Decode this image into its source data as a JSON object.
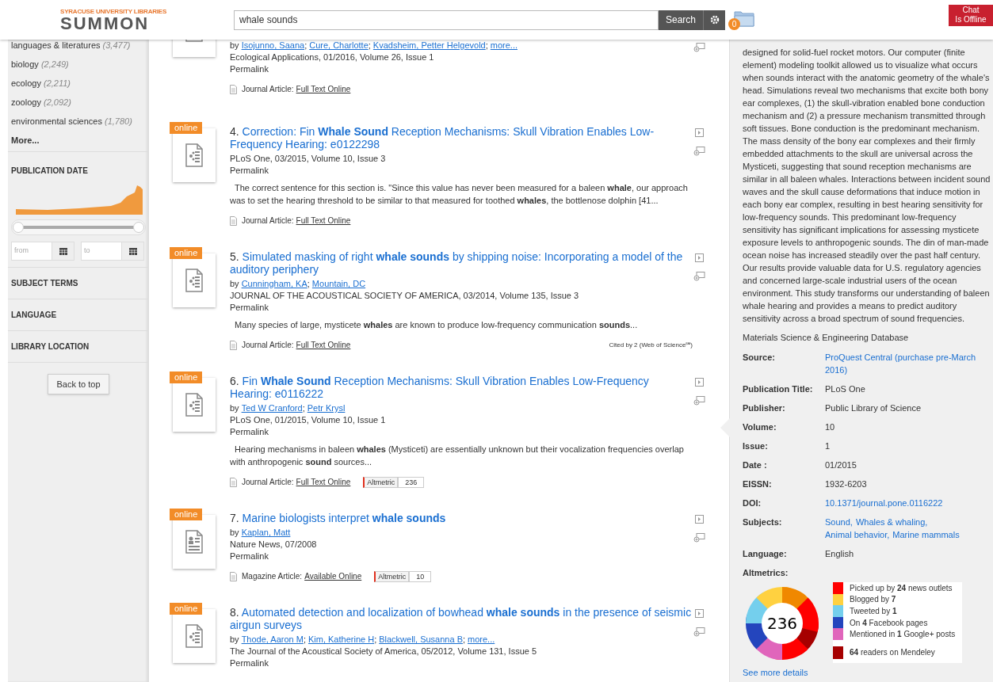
{
  "header": {
    "logo_top": "SYRACUSE UNIVERSITY LIBRARIES",
    "logo_main": "SUMMON",
    "search": {
      "value": "whale sounds"
    },
    "search_button": "Search",
    "folder_count": "0",
    "chat": [
      "Chat",
      "Is Offline"
    ]
  },
  "sidebar": {
    "subjects": [
      {
        "label": "languages & literatures",
        "count": "(3,477)"
      },
      {
        "label": "biology",
        "count": "(2,249)"
      },
      {
        "label": "ecology",
        "count": "(2,211)"
      },
      {
        "label": "zoology",
        "count": "(2,092)"
      },
      {
        "label": "environmental sciences",
        "count": "(1,780)"
      }
    ],
    "more": "More...",
    "date_heading": "PUBLICATION DATE",
    "date_range": {
      "level": 1
    },
    "from_placeholder": "from",
    "to_placeholder": "to",
    "sections": [
      "SUBJECT TERMS",
      "LANGUAGE",
      "LIBRARY LOCATION"
    ],
    "back_to_top": "Back to top"
  },
  "results": [
    {
      "kind": "article",
      "by": "by",
      "authors": [
        {
          "name": "Isojunno, Saana",
          "sep": ";"
        },
        {
          "name": "Cure, Charlotte",
          "sep": ";"
        },
        {
          "name": "Kvadsheim, Petter Helgevold",
          "sep": ";"
        }
      ],
      "more": "more...",
      "source": "Ecological Applications, 01/2016, Volume 26, Issue 1",
      "permalink": "Permalink",
      "format": "Journal Article:",
      "access": "Full Text Online"
    },
    {
      "kind": "article",
      "badge": "online",
      "number": "4.",
      "title": "Correction: Fin **Whale Sound** Reception Mechanisms: Skull Vibration Enables Low-Frequency Hearing: e0122298",
      "source": "PLoS One, 03/2015, Volume 10, Issue 3",
      "permalink": "Permalink",
      "snippet": "The correct sentence for this section is. \"Since this value has never been measured for a baleen **whale**, our approach was to set the hearing threshold to be similar to that measured for toothed **whales**, the bottlenose dolphin [41...",
      "format": "Journal Article:",
      "access": "Full Text Online"
    },
    {
      "kind": "article",
      "badge": "online",
      "number": "5.",
      "title": "Simulated masking of right **whale sounds** by shipping noise: Incorporating a model of the auditory periphery",
      "by": "by",
      "authors": [
        {
          "name": "Cunningham, KA",
          "sep": ";"
        },
        {
          "name": "Mountain, DC"
        }
      ],
      "source": "JOURNAL OF THE ACOUSTICAL SOCIETY OF AMERICA, 03/2014, Volume 135, Issue 3",
      "permalink": "Permalink",
      "snippet": "Many species of large, mysticete **whales** are known to produce low-frequency communication **sounds**...",
      "format": "Journal Article:",
      "access": "Full Text Online",
      "cited": "Cited by 2 (Web of Science℠)"
    },
    {
      "kind": "article",
      "badge": "online",
      "number": "6.",
      "title": "Fin **Whale Sound** Reception Mechanisms: Skull Vibration Enables Low-Frequency Hearing: e0116222",
      "by": "by",
      "authors": [
        {
          "name": "Ted W Cranford",
          "sep": ";"
        },
        {
          "name": "Petr Krysl"
        }
      ],
      "source": "PLoS One, 01/2015, Volume 10, Issue 1",
      "permalink": "Permalink",
      "snippet": "Hearing mechanisms in baleen **whales** (Mysticeti) are essentially unknown but their vocalization frequencies overlap with anthropogenic **sound** sources...",
      "format": "Journal Article:",
      "access": "Full Text Online",
      "altmetric": {
        "label": "Altmetric",
        "score": "236"
      }
    },
    {
      "kind": "magazine",
      "badge": "online",
      "number": "7.",
      "title": "Marine biologists interpret **whale sounds**",
      "by": "by",
      "authors": [
        {
          "name": "Kaplan, Matt"
        }
      ],
      "source": "Nature News, 07/2008",
      "permalink": "Permalink",
      "format": "Magazine Article:",
      "access": "Available Online",
      "altmetric": {
        "label": "Altmetric",
        "score": "10"
      }
    },
    {
      "kind": "article",
      "badge": "online",
      "number": "8.",
      "title": "Automated detection and localization of bowhead **whale sounds** in the presence of seismic airgun surveys",
      "by": "by",
      "authors": [
        {
          "name": "Thode, Aaron M",
          "sep": ";"
        },
        {
          "name": "Kim, Katherine H",
          "sep": ";"
        },
        {
          "name": "Blackwell, Susanna B",
          "sep": ";"
        }
      ],
      "more": "more...",
      "source": "The Journal of the Acoustical Society of America, 05/2012, Volume 131, Issue 5",
      "permalink": "Permalink"
    }
  ],
  "detail": {
    "abstract": "designed for solid-fuel rocket motors. Our computer (finite element) modeling toolkit allowed us to visualize what occurs when sounds interact with the anatomic geometry of the whale's head. Simulations reveal two mechanisms that excite both bony ear complexes, (1) the skull-vibration enabled bone conduction mechanism and (2) a pressure mechanism transmitted through soft tissues. Bone conduction is the predominant mechanism. The mass density of the bony ear complexes and their firmly embedded attachments to the skull are universal across the Mysticeti, suggesting that sound reception mechanisms are similar in all baleen whales. Interactions between incident sound waves and the skull cause deformations that induce motion in each bony ear complex, resulting in best hearing sensitivity for low-frequency sounds. This predominant low-frequency sensitivity has significant implications for assessing mysticete exposure levels to anthropogenic sounds. The din of man-made ocean noise has increased steadily over the past half century. Our results provide valuable data for U.S. regulatory agencies and concerned large-scale industrial users of the ocean environment. This study transforms our understanding of baleen whale hearing and provides a means to predict auditory sensitivity across a broad spectrum of sound frequencies.",
    "database": "Materials Science & Engineering Database",
    "fields": [
      {
        "label": "Source:",
        "kind": "link",
        "values": [
          "ProQuest Central (purchase pre-March 2016)"
        ]
      },
      {
        "label": "Publication Title:",
        "kind": "text",
        "values": [
          "PLoS One"
        ]
      },
      {
        "label": "Publisher:",
        "kind": "text",
        "values": [
          "Public Library of Science"
        ]
      },
      {
        "label": "Volume:",
        "kind": "text",
        "values": [
          "10"
        ]
      },
      {
        "label": "Issue:",
        "kind": "text",
        "values": [
          "1"
        ]
      },
      {
        "label": "Date :",
        "kind": "text",
        "values": [
          "01/2015"
        ]
      },
      {
        "label": "EISSN:",
        "kind": "text",
        "values": [
          "1932-6203"
        ]
      },
      {
        "label": "DOI:",
        "kind": "link",
        "values": [
          "10.1371/journal.pone.0116222"
        ]
      },
      {
        "label": "Subjects:",
        "kind": "link",
        "values": [
          "Sound,",
          "Whales & whaling,",
          "Animal behavior,",
          "Marine mammals"
        ]
      },
      {
        "label": "Language:",
        "kind": "text",
        "values": [
          "English"
        ]
      }
    ],
    "altmetrics_label": "Altmetrics:",
    "score": "236",
    "legend": [
      {
        "text": "Picked up by **24** news outlets",
        "color": "#ff0000"
      },
      {
        "text": "Blogged by **7**",
        "color": "#ffd140"
      },
      {
        "text": "Tweeted by **1**",
        "color": "#74cfed"
      },
      {
        "text": "On **4** Facebook pages",
        "color": "#2445bd"
      },
      {
        "text": "Mentioned in **1** Google+ posts",
        "color": "#e065bb"
      },
      {
        "text": "**64** readers on Mendeley",
        "color": "#a60000"
      }
    ],
    "see_more": "See more details"
  }
}
